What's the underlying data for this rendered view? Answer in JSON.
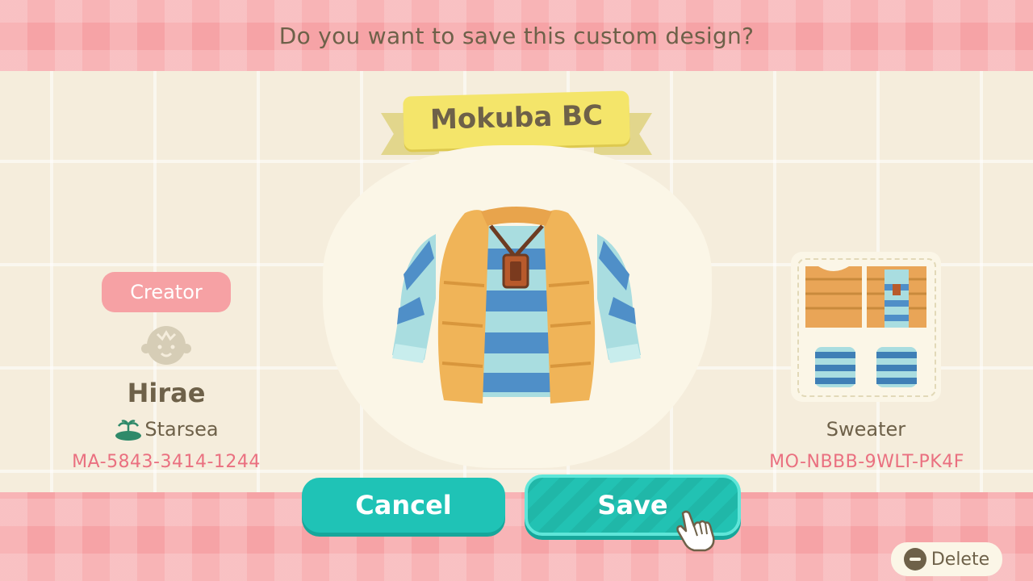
{
  "dialog": {
    "question": "Do you want to save this custom design?",
    "design_title": "Mokuba BC"
  },
  "creator": {
    "label": "Creator",
    "name": "Hirae",
    "island": "Starsea",
    "code": "MA-5843-3414-1244",
    "avatar_icon": "villager-head-icon",
    "island_icon": "island-icon"
  },
  "design": {
    "item_type": "Sweater",
    "code": "MO-NBBB-9WLT-PK4F"
  },
  "buttons": {
    "cancel_label": "Cancel",
    "save_label": "Save",
    "delete_label": "Delete"
  },
  "colors": {
    "accent_teal": "#1fc3b6",
    "pink": "#f6a1a4",
    "code_pink": "#ea7080",
    "ribbon_yellow": "#f4e56a"
  }
}
